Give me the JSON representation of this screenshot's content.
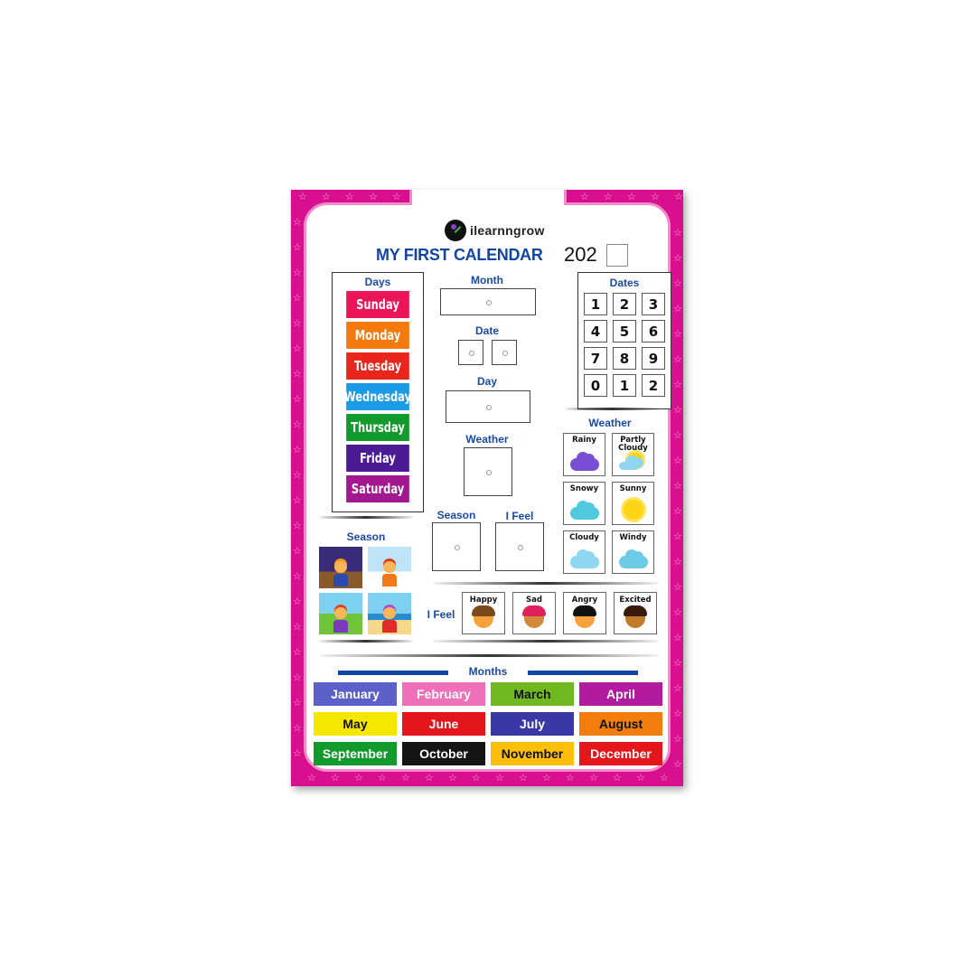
{
  "brand": {
    "name": "ilearnngrow",
    "logo_icon": "ilearnngrow-logo-icon"
  },
  "header": {
    "title": "MY FIRST CALENDAR",
    "year_prefix": "202",
    "year_last_digit": ""
  },
  "colors": {
    "border_pink": "#d8108f",
    "inner_outline": "#f48ac9",
    "heading_blue": "#1a4aa8",
    "star": "#f6a9d6"
  },
  "days": {
    "heading": "Days",
    "items": [
      {
        "label": "Sunday",
        "color": "#ea1457"
      },
      {
        "label": "Monday",
        "color": "#f47a0f"
      },
      {
        "label": "Tuesday",
        "color": "#e8261c"
      },
      {
        "label": "Wednesday",
        "color": "#1b9be6"
      },
      {
        "label": "Thursday",
        "color": "#139a2c"
      },
      {
        "label": "Friday",
        "color": "#4a1b95"
      },
      {
        "label": "Saturday",
        "color": "#a2188f"
      }
    ]
  },
  "slots": {
    "month": "Month",
    "date": "Date",
    "day": "Day",
    "weather": "Weather",
    "season": "Season",
    "feel": "I Feel"
  },
  "dates": {
    "heading": "Dates",
    "tiles": [
      "1",
      "2",
      "3",
      "4",
      "5",
      "6",
      "7",
      "8",
      "9",
      "0",
      "1",
      "2"
    ]
  },
  "weather": {
    "heading": "Weather",
    "tiles": [
      {
        "label": "Rainy",
        "icon": "rain-cloud-icon"
      },
      {
        "label": "Partly Cloudy",
        "icon": "partly-cloudy-icon"
      },
      {
        "label": "Snowy",
        "icon": "snow-cloud-icon"
      },
      {
        "label": "Sunny",
        "icon": "sun-icon"
      },
      {
        "label": "Cloudy",
        "icon": "cloud-icon"
      },
      {
        "label": "Windy",
        "icon": "wind-cloud-icon"
      }
    ]
  },
  "season": {
    "heading": "Season",
    "pictures": [
      {
        "name": "rainy-season-picture"
      },
      {
        "name": "winter-season-picture"
      },
      {
        "name": "spring-season-picture"
      },
      {
        "name": "summer-season-picture"
      }
    ]
  },
  "feelings": {
    "heading": "I Feel",
    "tiles": [
      {
        "label": "Happy"
      },
      {
        "label": "Sad"
      },
      {
        "label": "Angry"
      },
      {
        "label": "Excited"
      }
    ]
  },
  "months": {
    "heading": "Months",
    "items": [
      {
        "label": "January",
        "bg": "#5b5fc7",
        "fg": "#ffffff"
      },
      {
        "label": "February",
        "bg": "#f06fb9",
        "fg": "#ffffff"
      },
      {
        "label": "March",
        "bg": "#6fb820",
        "fg": "#111111"
      },
      {
        "label": "April",
        "bg": "#b21aa0",
        "fg": "#ffffff"
      },
      {
        "label": "May",
        "bg": "#f5e700",
        "fg": "#111111"
      },
      {
        "label": "June",
        "bg": "#e3161b",
        "fg": "#ffffff"
      },
      {
        "label": "July",
        "bg": "#3a38a6",
        "fg": "#ffffff"
      },
      {
        "label": "August",
        "bg": "#f27d0c",
        "fg": "#111111"
      },
      {
        "label": "September",
        "bg": "#139a2c",
        "fg": "#ffffff"
      },
      {
        "label": "October",
        "bg": "#151515",
        "fg": "#ffffff"
      },
      {
        "label": "November",
        "bg": "#fdbf0a",
        "fg": "#111111"
      },
      {
        "label": "December",
        "bg": "#e3161b",
        "fg": "#ffffff"
      }
    ]
  }
}
